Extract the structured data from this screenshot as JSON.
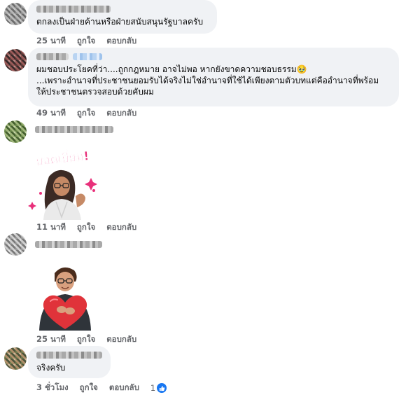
{
  "comments": [
    {
      "text": "ตกลงเป็นฝ่ายค้านหรือฝ่ายสนับสนุนรัฐบาลครับ",
      "time": "25 นาที",
      "like": "ถูกใจ",
      "reply": "ตอบกลับ"
    },
    {
      "text": "ผมชอบประโยคที่ว่า....ถูกกฎหมาย อาจไม่พอ หากยังขาดความชอบธรรม🥹\n...เพราะอำนาจที่ประชาชนยอมรับได้จริงไม่ใช่อำนาจที่ใช้ได้เพียงตามตัวบทแต่คืออำนาจที่พร้อม\nให้ประชาชนตรวจสอบด้วยคับผม",
      "time": "49 นาที",
      "like": "ถูกใจ",
      "reply": "ตอบกลับ"
    },
    {
      "sticker_caption": "ยอดเยี่ยม!",
      "time": "11 นาที",
      "like": "ถูกใจ",
      "reply": "ตอบกลับ"
    },
    {
      "sticker": "hug-heart",
      "time": "25 นาที",
      "like": "ถูกใจ",
      "reply": "ตอบกลับ"
    },
    {
      "text": "จริงครับ",
      "time": "3 ชั่วโมง",
      "like": "ถูกใจ",
      "reply": "ตอบกลับ",
      "reaction_count": "1"
    }
  ],
  "colors": {
    "bubble": "#f0f2f5",
    "meta_text": "#65676b",
    "like_blue": "#1877f2",
    "sticker_pink": "#e8307a"
  }
}
